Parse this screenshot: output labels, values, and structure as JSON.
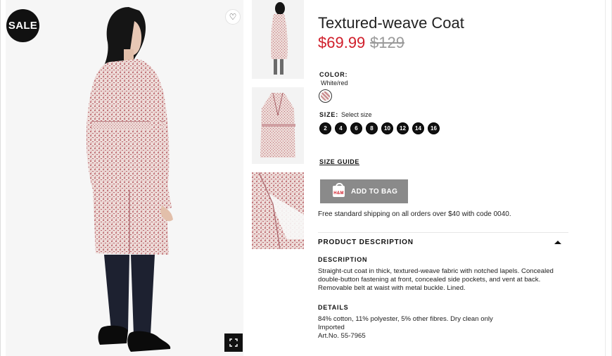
{
  "product": {
    "badge": "SALE",
    "title": "Textured-weave Coat",
    "price_now": "$69.99",
    "price_old": "$129"
  },
  "color": {
    "label": "COLOR:",
    "value": "White/red"
  },
  "size": {
    "label": "SIZE:",
    "value": "Select size",
    "options": [
      "2",
      "4",
      "6",
      "8",
      "10",
      "12",
      "14",
      "16"
    ]
  },
  "actions": {
    "size_guide": "SIZE GUIDE",
    "add_to_bag": "ADD TO BAG",
    "bag_icon_text": "H&M"
  },
  "shipping_note": "Free standard shipping on all orders over $40 with code 0040.",
  "product_description": {
    "section_title": "PRODUCT DESCRIPTION",
    "description_heading": "DESCRIPTION",
    "description_text": "Straight-cut coat in thick, textured-weave fabric with notched lapels. Concealed double-button fastening at front, concealed side pockets, and vent at back. Removable belt at waist with metal buckle. Lined.",
    "details_heading": "DETAILS",
    "details_lines": [
      "84% cotton, 11% polyester, 5% other fibres. Dry clean only",
      "Imported",
      "Art.No. 55-7965"
    ]
  },
  "icons": {
    "favorite": "heart-icon",
    "fullscreen": "expand-icon",
    "collapse": "caret-up-icon",
    "bag": "shopping-bag-icon"
  },
  "colors": {
    "sale_price": "#d01e2a",
    "add_button": "#8a8a8a",
    "badge": "#111111"
  }
}
